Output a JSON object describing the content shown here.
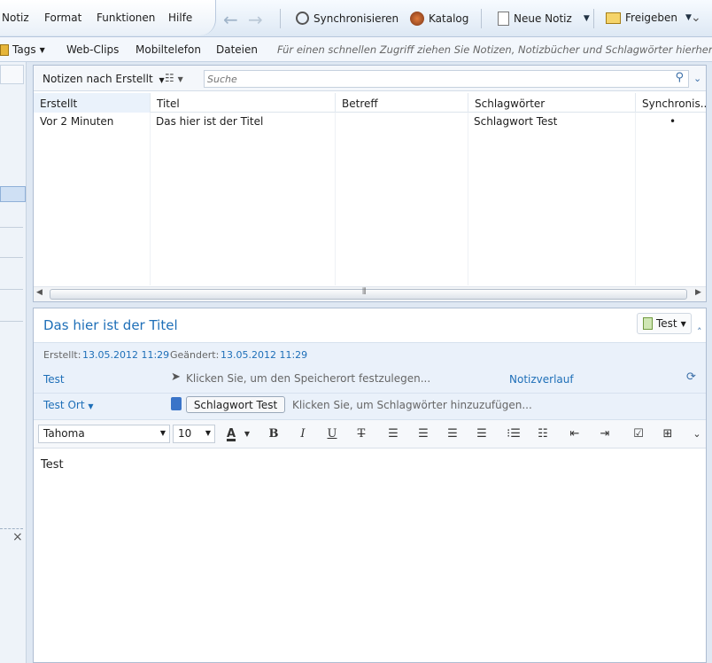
{
  "menu": {
    "items": [
      "Notiz",
      "Format",
      "Funktionen",
      "Hilfe"
    ]
  },
  "toolbar": {
    "sync_label": "Synchronisieren",
    "catalog_label": "Katalog",
    "new_note_label": "Neue Notiz",
    "share_label": "Freigeben"
  },
  "shortcuts": {
    "tags_label": "Tags",
    "webclips_label": "Web-Clips",
    "mobile_label": "Mobiltelefon",
    "files_label": "Dateien",
    "hint": "Für einen schnellen Zugriff ziehen Sie Notizen, Notizbücher und Schlagwörter hierher."
  },
  "list": {
    "sort_label": "Notizen nach Erstellt",
    "search_placeholder": "Suche",
    "columns": [
      "Erstellt",
      "Titel",
      "Betreff",
      "Schlagwörter",
      "Synchronis..."
    ],
    "rows": [
      {
        "created": "Vor 2 Minuten",
        "title": "Das hier ist der Titel",
        "subject": "",
        "tags": "Schlagwort Test",
        "sync": "•"
      }
    ],
    "scroll_grip": "⦀"
  },
  "note": {
    "title": "Das hier ist der Titel",
    "notebook": "Test",
    "created_label": "Erstellt:",
    "created_value": "13.05.2012 11:29",
    "modified_label": "Geändert:",
    "modified_value": "13.05.2012 11:29",
    "author": "Test",
    "location_placeholder": "Klicken Sie, um den Speicherort festzulegen...",
    "history_label": "Notizverlauf",
    "place": "Test Ort",
    "tag_chip": "Schlagwort Test",
    "tag_placeholder": "Klicken Sie, um Schlagwörter hinzuzufügen...",
    "body": "Test"
  },
  "format": {
    "font": "Tahoma",
    "size": "10",
    "font_color_glyph": "A",
    "bold": "B",
    "italic": "I",
    "underline": "U",
    "strike": "T"
  },
  "left": {
    "close_glyph": "×"
  },
  "colors": {
    "accent": "#1e6fb8",
    "panel_border": "#aebdd2",
    "meta_bg": "#eaf1fa"
  }
}
